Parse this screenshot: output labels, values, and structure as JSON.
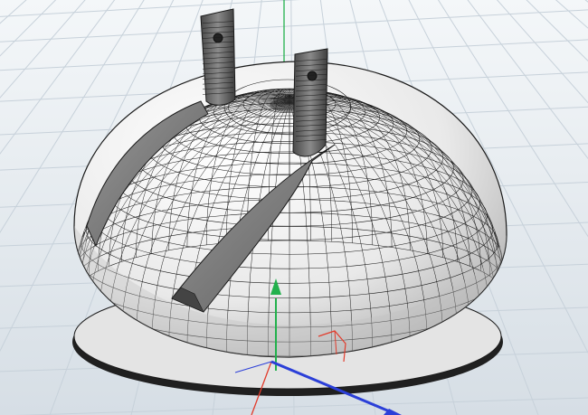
{
  "viewport": {
    "colors": {
      "background_top": "#f4f7f9",
      "background_bottom": "#d6dee5",
      "grid": "#c7d1da",
      "mesh_fill": "#f7f7f7",
      "mesh_shade": "#bfbfbf",
      "wire": "#1a1a1a",
      "axis_x": "#e23b2b",
      "axis_y": "#22b14c",
      "axis_z": "#2b3fd8",
      "prong": "#5a5a5a"
    },
    "objects": [
      {
        "name": "hemisphere-plug-mesh",
        "icon": "wireframe-dome"
      },
      {
        "name": "plug-prong-left",
        "icon": "prong"
      },
      {
        "name": "plug-prong-right",
        "icon": "prong"
      }
    ],
    "gizmos": [
      "move-gizmo-y-arrow",
      "orientation-gizmo",
      "world-axes"
    ]
  }
}
